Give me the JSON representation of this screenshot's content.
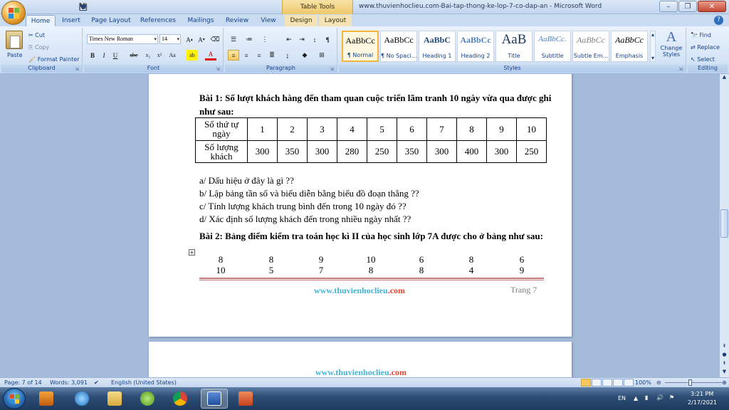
{
  "window": {
    "title": "www.thuvienhoclieu.com-Bai-tap-thong-ke-lop-7-co-dap-an - Microsoft Word",
    "context_tab": "Table Tools",
    "qat_underline": "U"
  },
  "ribbon": {
    "tabs": [
      "Home",
      "Insert",
      "Page Layout",
      "References",
      "Mailings",
      "Review",
      "View",
      "Design",
      "Layout"
    ],
    "clipboard": {
      "label": "Clipboard",
      "paste": "Paste",
      "cut": "Cut",
      "copy": "Copy",
      "format_painter": "Format Painter"
    },
    "font": {
      "label": "Font",
      "name": "Times New Roman",
      "size": "14"
    },
    "paragraph": {
      "label": "Paragraph"
    },
    "styles": {
      "label": "Styles",
      "items": [
        {
          "sample": "AaBbCc",
          "name": "¶ Normal"
        },
        {
          "sample": "AaBbCc",
          "name": "¶ No Spaci..."
        },
        {
          "sample": "AaBbC",
          "name": "Heading 1"
        },
        {
          "sample": "AaBbCc",
          "name": "Heading 2"
        },
        {
          "sample": "AaB",
          "name": "Title"
        },
        {
          "sample": "AaBbCc.",
          "name": "Subtitle"
        },
        {
          "sample": "AaBbCc",
          "name": "Subtle Em..."
        },
        {
          "sample": "AaBbCc",
          "name": "Emphasis"
        }
      ],
      "change_styles": "Change Styles"
    },
    "editing": {
      "label": "Editing",
      "find": "Find",
      "replace": "Replace",
      "select": "Select"
    }
  },
  "document": {
    "bai1_title": "Bài 1:  Số lượt khách hàng đến tham quan cuộc triển lãm tranh 10 ngày vừa qua được ghi như sau:",
    "table": {
      "row1_head": "Số thứ tự ngày",
      "row2_head": "Số lượng khách",
      "days": [
        "1",
        "2",
        "3",
        "4",
        "5",
        "6",
        "7",
        "8",
        "9",
        "10"
      ],
      "visitors": [
        "300",
        "350",
        "300",
        "280",
        "250",
        "350",
        "300",
        "400",
        "300",
        "250"
      ]
    },
    "questions": [
      "a/ Dấu hiệu ở đây là gì ??",
      "b/ Lập bảng tần số và biểu diễn bằng biểu đồ đoạn thẳng ??",
      "c/ Tính lượng khách trung bình đến trong 10 ngày đó ??",
      "d/ Xác định số lượng khách đến trong nhiều ngày nhất ??"
    ],
    "bai2_title": "Bài 2: Bảng điểm kiểm tra  toán học kì II của học sinh lớp 7A được cho ở bảng như sau:",
    "scores_row1": [
      "8",
      "8",
      "9",
      "10",
      "6",
      "8",
      "6"
    ],
    "scores_row2": [
      "10",
      "5",
      "7",
      "8",
      "8",
      "4",
      "9"
    ],
    "footer_url_1": "www.thuvienhoclieu",
    "footer_url_2": ".com",
    "footer_page": "Trang 7",
    "page2_header_1": "www.thuvienhoclieu",
    "page2_header_2": ".com"
  },
  "statusbar": {
    "page": "Page: 7 of 14",
    "words": "Words: 3,091",
    "language": "English (United States)",
    "zoom": "100%"
  },
  "taskbar": {
    "lang": "EN",
    "time": "3:21 PM",
    "date": "2/17/2021"
  }
}
